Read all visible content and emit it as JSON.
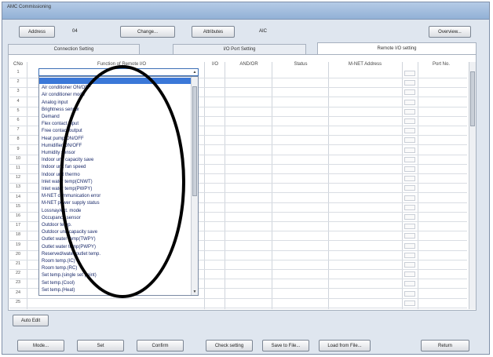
{
  "window": {
    "title": "AMC Commissioning"
  },
  "top_bar": {
    "address_button": "Address",
    "address_value": "04",
    "change_button": "Change...",
    "attributes_button": "Attributes",
    "attributes_value": "AIC",
    "overview_button": "Overview..."
  },
  "tabs": [
    {
      "label": "Connection Setting"
    },
    {
      "label": "I/O Port Setting"
    },
    {
      "label": "Remote I/O setting"
    }
  ],
  "grid": {
    "headers": {
      "no": "CNo",
      "function": "Function of Remote I/O",
      "io": "I/O",
      "andor": "AND/OR",
      "status": "Status",
      "address": "M-NET Address",
      "portno": "Port No."
    },
    "row_numbers": [
      "1",
      "2",
      "3",
      "4",
      "5",
      "6",
      "7",
      "8",
      "9",
      "10",
      "11",
      "12",
      "13",
      "14",
      "15",
      "16",
      "17",
      "18",
      "19",
      "20",
      "21",
      "22",
      "23",
      "24",
      "25"
    ]
  },
  "dropdown_list": {
    "items": [
      "",
      "Air conditioner ON/OFF",
      "Air conditioner mode",
      "Analog input",
      "Brightness sensor",
      "Demand",
      "Flex contact input",
      "Free contact output",
      "Heat pump ON/OFF",
      "Humidifier ON/OFF",
      "Humidity sensor",
      "Indoor unit capacity save",
      "Indoor unit fan speed",
      "Indoor unit thermo",
      "Inlet water temp(CNWT)",
      "Inlet water temp(PWPY)",
      "M-NET communication error",
      "M-NET power supply status",
      "Lossnay/ext. mode",
      "Occupancy sensor",
      "Outdoor temp.",
      "Outdoor unit capacity save",
      "Outlet water temp(TWPY)",
      "Outlet water temp(PWPY)",
      "Reserved/water outlet temp.",
      "Room temp.(IC)",
      "Room temp.(RC)",
      "Set temp.(single set point)",
      "Set temp.(Cool)",
      "Set temp.(Heat)"
    ]
  },
  "bottom": {
    "auto_edit": "Auto Edit",
    "mode_button": "Mode...",
    "set_button": "Set",
    "confirm_button": "Confirm",
    "check_setting_button": "Check setting",
    "save_file_button": "Save to File...",
    "load_file_button": "Load from File...",
    "return_button": "Return"
  },
  "colors": {
    "selection": "#3b78d8",
    "annotation_ellipse": "#000000"
  }
}
